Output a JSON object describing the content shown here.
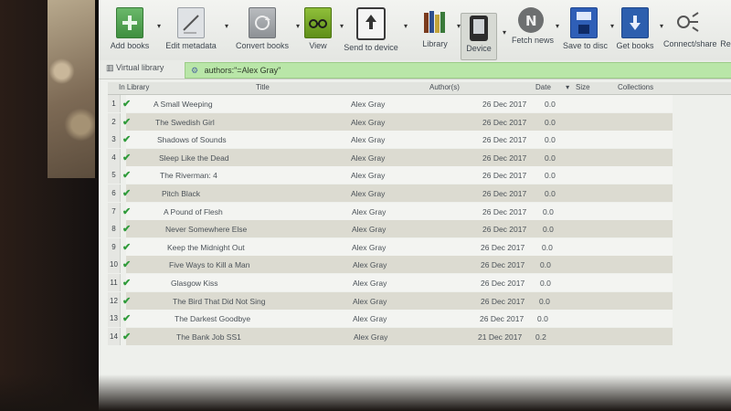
{
  "toolbar": {
    "buttons": [
      {
        "label": "Add books",
        "icon": "add-books-icon"
      },
      {
        "label": "Edit metadata",
        "icon": "edit-metadata-icon"
      },
      {
        "label": "Convert books",
        "icon": "convert-books-icon"
      },
      {
        "label": "View",
        "icon": "view-icon"
      },
      {
        "label": "Send to device",
        "icon": "send-to-device-icon"
      },
      {
        "label": "Library",
        "icon": "library-icon"
      },
      {
        "label": "Device",
        "icon": "device-icon"
      },
      {
        "label": "Fetch news",
        "icon": "fetch-news-icon"
      },
      {
        "label": "Save to disc",
        "icon": "save-to-disc-icon"
      },
      {
        "label": "Get books",
        "icon": "get-books-icon"
      },
      {
        "label": "Connect/share",
        "icon": "connect-share-icon"
      },
      {
        "label": "Re",
        "icon": "remove-icon"
      }
    ]
  },
  "virtual_library": {
    "label": "Virtual library"
  },
  "search": {
    "value": "authors:\"=Alex Gray\""
  },
  "table": {
    "headers": {
      "in_library": "In Library",
      "title": "Title",
      "authors": "Author(s)",
      "date": "Date",
      "size": "Size",
      "collections": "Collections"
    },
    "rows": [
      {
        "num": "1",
        "title": "A Small Weeping",
        "author": "Alex Gray",
        "date": "26 Dec 2017",
        "size": "0.0"
      },
      {
        "num": "2",
        "title": "The Swedish Girl",
        "author": "Alex Gray",
        "date": "26 Dec 2017",
        "size": "0.0"
      },
      {
        "num": "3",
        "title": "Shadows of Sounds",
        "author": "Alex Gray",
        "date": "26 Dec 2017",
        "size": "0.0"
      },
      {
        "num": "4",
        "title": "Sleep Like the Dead",
        "author": "Alex Gray",
        "date": "26 Dec 2017",
        "size": "0.0"
      },
      {
        "num": "5",
        "title": "The Riverman: 4",
        "author": "Alex Gray",
        "date": "26 Dec 2017",
        "size": "0.0"
      },
      {
        "num": "6",
        "title": "Pitch Black",
        "author": "Alex Gray",
        "date": "26 Dec 2017",
        "size": "0.0"
      },
      {
        "num": "7",
        "title": "A Pound of Flesh",
        "author": "Alex Gray",
        "date": "26 Dec 2017",
        "size": "0.0"
      },
      {
        "num": "8",
        "title": "Never Somewhere Else",
        "author": "Alex Gray",
        "date": "26 Dec 2017",
        "size": "0.0"
      },
      {
        "num": "9",
        "title": "Keep the Midnight Out",
        "author": "Alex Gray",
        "date": "26 Dec 2017",
        "size": "0.0"
      },
      {
        "num": "10",
        "title": "Five Ways to Kill a Man",
        "author": "Alex Gray",
        "date": "26 Dec 2017",
        "size": "0.0"
      },
      {
        "num": "11",
        "title": "Glasgow Kiss",
        "author": "Alex Gray",
        "date": "26 Dec 2017",
        "size": "0.0"
      },
      {
        "num": "12",
        "title": "The Bird That Did Not Sing",
        "author": "Alex Gray",
        "date": "26 Dec 2017",
        "size": "0.0"
      },
      {
        "num": "13",
        "title": "The Darkest Goodbye",
        "author": "Alex Gray",
        "date": "26 Dec 2017",
        "size": "0.0"
      },
      {
        "num": "14",
        "title": "The Bank Job SS1",
        "author": "Alex Gray",
        "date": "21 Dec 2017",
        "size": "0.2"
      }
    ]
  }
}
